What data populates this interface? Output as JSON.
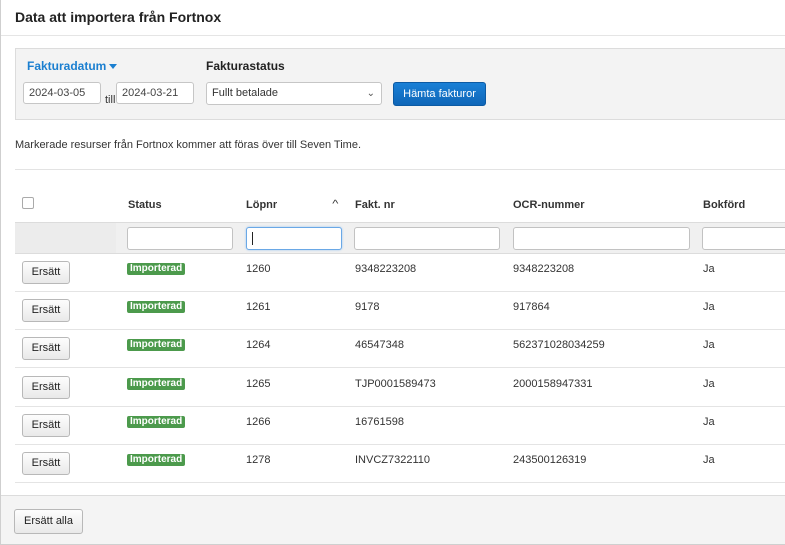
{
  "dialog": {
    "title": "Data att importera från Fortnox"
  },
  "filters": {
    "date_label": "Fakturadatum",
    "date_from": "2024-03-05",
    "till": "till",
    "date_to": "2024-03-21",
    "status_label": "Fakturastatus",
    "status_value": "Fullt betalade",
    "fetch_button": "Hämta fakturor"
  },
  "info_text": "Markerade resurser från Fortnox kommer att föras över till Seven Time.",
  "table": {
    "columns": {
      "status": "Status",
      "lopnr": "Löpnr",
      "fakt_nr": "Fakt. nr",
      "ocr": "OCR-nummer",
      "bokford": "Bokförd"
    },
    "sorted_column": "lopnr",
    "sort_direction": "ascending",
    "rows": [
      {
        "button": "Ersätt",
        "status": "Importerad",
        "lopnr": "1260",
        "fakt_nr": "9348223208",
        "ocr": "9348223208",
        "bokford": "Ja"
      },
      {
        "button": "Ersätt",
        "status": "Importerad",
        "lopnr": "1261",
        "fakt_nr": "9178",
        "ocr": "917864",
        "bokford": "Ja"
      },
      {
        "button": "Ersätt",
        "status": "Importerad",
        "lopnr": "1264",
        "fakt_nr": "46547348",
        "ocr": "562371028034259",
        "bokford": "Ja"
      },
      {
        "button": "Ersätt",
        "status": "Importerad",
        "lopnr": "1265",
        "fakt_nr": "TJP0001589473",
        "ocr": "2000158947331",
        "bokford": "Ja"
      },
      {
        "button": "Ersätt",
        "status": "Importerad",
        "lopnr": "1266",
        "fakt_nr": "16761598",
        "ocr": "",
        "bokford": "Ja"
      },
      {
        "button": "Ersätt",
        "status": "Importerad",
        "lopnr": "1278",
        "fakt_nr": "INVCZ7322110",
        "ocr": "243500126319",
        "bokford": "Ja"
      }
    ]
  },
  "footer": {
    "replace_all_button": "Ersätt alla"
  },
  "colors": {
    "link": "#1b7fd0",
    "primary_button": "#1a80d6",
    "badge": "#4c9a4c"
  }
}
